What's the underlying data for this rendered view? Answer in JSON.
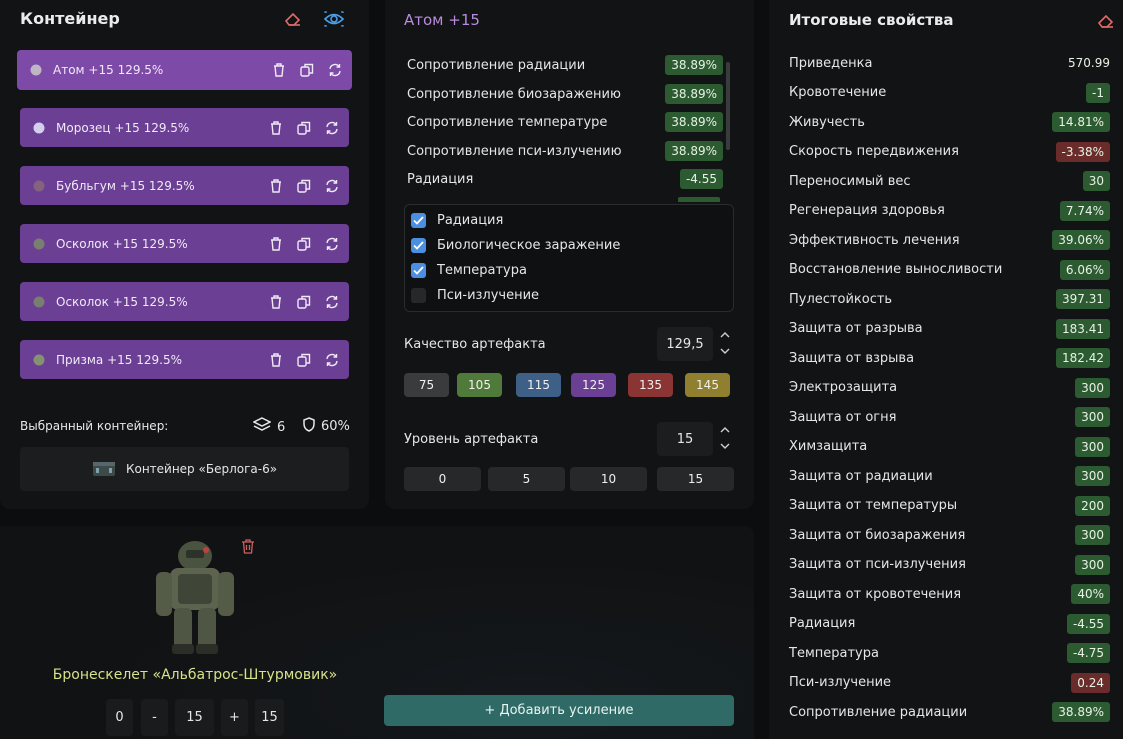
{
  "container": {
    "title": "Контейнер",
    "artifacts": [
      {
        "name": "Атом",
        "level": "+15",
        "quality": "129.5%",
        "active": true,
        "color": "#c9c9c9"
      },
      {
        "name": "Морозец",
        "level": "+15",
        "quality": "129.5%",
        "active": false,
        "color": "#e8e8ff"
      },
      {
        "name": "Бубльгум",
        "level": "+15",
        "quality": "129.5%",
        "active": false,
        "color": "#8a6a7a"
      },
      {
        "name": "Осколок",
        "level": "+15",
        "quality": "129.5%",
        "active": false,
        "color": "#7b8a6a"
      },
      {
        "name": "Осколок",
        "level": "+15",
        "quality": "129.5%",
        "active": false,
        "color": "#7b8a6a"
      },
      {
        "name": "Призма",
        "level": "+15",
        "quality": "129.5%",
        "active": false,
        "color": "#8aa06a"
      }
    ],
    "selected_label": "Выбранный контейнер:",
    "slots": "6",
    "protection": "60%",
    "container_name": "Контейнер «Берлога-6»"
  },
  "detail": {
    "title": "Атом +15",
    "properties": [
      {
        "name": "Сопротивление радиации",
        "value": "38.89%",
        "tone": "green"
      },
      {
        "name": "Сопротивление биозаражению",
        "value": "38.89%",
        "tone": "green"
      },
      {
        "name": "Сопротивление температуре",
        "value": "38.89%",
        "tone": "green"
      },
      {
        "name": "Сопротивление пси-излучению",
        "value": "38.89%",
        "tone": "green"
      },
      {
        "name": "Радиация",
        "value": "-4.55",
        "tone": "green"
      }
    ],
    "checks": [
      {
        "label": "Радиация",
        "checked": true
      },
      {
        "label": "Биологическое заражение",
        "checked": true
      },
      {
        "label": "Температура",
        "checked": true
      },
      {
        "label": "Пси-излучение",
        "checked": false
      }
    ],
    "quality_label": "Качество артефакта",
    "quality_value": "129,5",
    "quality_presets": [
      {
        "label": "75",
        "color": "#3a3b3d"
      },
      {
        "label": "105",
        "color": "#4f7a3a"
      },
      {
        "label": "115",
        "color": "#3e5f86"
      },
      {
        "label": "125",
        "color": "#6b3f93"
      },
      {
        "label": "135",
        "color": "#8a3434"
      },
      {
        "label": "145",
        "color": "#8f7f2e"
      }
    ],
    "level_label": "Уровень артефакта",
    "level_value": "15",
    "level_presets": [
      "0",
      "5",
      "10",
      "15"
    ]
  },
  "totals": {
    "title": "Итоговые свойства",
    "rows": [
      {
        "name": "Приведенка",
        "value": "570.99",
        "tone": "plain"
      },
      {
        "name": "Кровотечение",
        "value": "-1",
        "tone": "green"
      },
      {
        "name": "Живучесть",
        "value": "14.81%",
        "tone": "green"
      },
      {
        "name": "Скорость передвижения",
        "value": "-3.38%",
        "tone": "red"
      },
      {
        "name": "Переносимый вес",
        "value": "30",
        "tone": "green"
      },
      {
        "name": "Регенерация здоровья",
        "value": "7.74%",
        "tone": "green"
      },
      {
        "name": "Эффективность лечения",
        "value": "39.06%",
        "tone": "green"
      },
      {
        "name": "Восстановление выносливости",
        "value": "6.06%",
        "tone": "green"
      },
      {
        "name": "Пулестойкость",
        "value": "397.31",
        "tone": "green"
      },
      {
        "name": "Защита от разрыва",
        "value": "183.41",
        "tone": "green"
      },
      {
        "name": "Защита от взрыва",
        "value": "182.42",
        "tone": "green"
      },
      {
        "name": "Электрозащита",
        "value": "300",
        "tone": "green"
      },
      {
        "name": "Защита от огня",
        "value": "300",
        "tone": "green"
      },
      {
        "name": "Химзащита",
        "value": "300",
        "tone": "green"
      },
      {
        "name": "Защита от радиации",
        "value": "300",
        "tone": "green"
      },
      {
        "name": "Защита от температуры",
        "value": "200",
        "tone": "green"
      },
      {
        "name": "Защита от биозаражения",
        "value": "300",
        "tone": "green"
      },
      {
        "name": "Защита от пси-излучения",
        "value": "300",
        "tone": "green"
      },
      {
        "name": "Защита от кровотечения",
        "value": "40%",
        "tone": "green"
      },
      {
        "name": "Радиация",
        "value": "-4.55",
        "tone": "green"
      },
      {
        "name": "Температура",
        "value": "-4.75",
        "tone": "green"
      },
      {
        "name": "Пси-излучение",
        "value": "0.24",
        "tone": "red"
      },
      {
        "name": "Сопротивление радиации",
        "value": "38.89%",
        "tone": "green"
      }
    ]
  },
  "armor": {
    "name": "Бронескелет «Альбатрос-Штурмовик»",
    "min_label": "0",
    "minus_label": "-",
    "level_value": "15",
    "plus_label": "+",
    "max_label": "15",
    "add_button": "+ Добавить усиление"
  },
  "colors": {
    "accent_purple": "#6b3f93",
    "title_purple": "#b98be0",
    "badge_green": "#2c5a31",
    "badge_red": "#6a2c2b",
    "checkbox_blue": "#4a8fe0",
    "armor_name": "#d7e28a",
    "add_button": "#2f6a66"
  }
}
